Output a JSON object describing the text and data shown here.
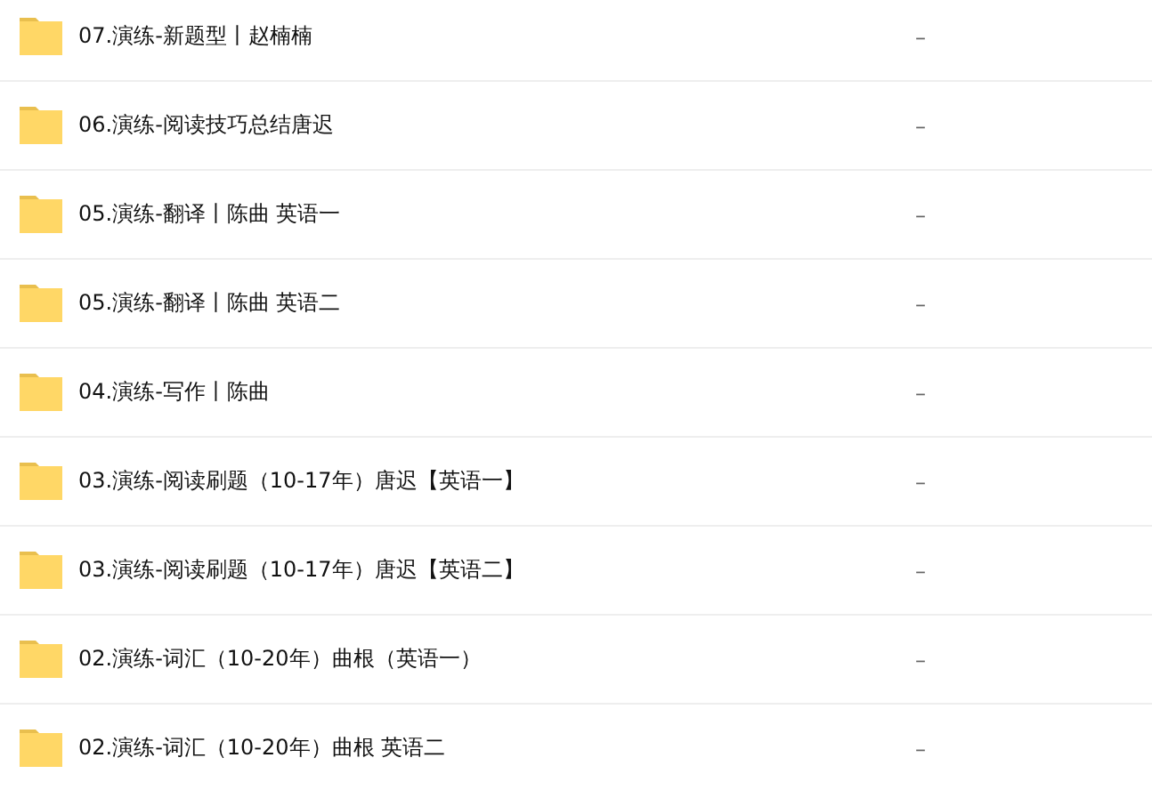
{
  "files": [
    {
      "name": "07.演练-新题型丨赵楠楠",
      "size": "–"
    },
    {
      "name": "06.演练-阅读技巧总结唐迟",
      "size": "–"
    },
    {
      "name": "05.演练-翻译丨陈曲 英语一",
      "size": "–"
    },
    {
      "name": "05.演练-翻译丨陈曲 英语二",
      "size": "–"
    },
    {
      "name": "04.演练-写作丨陈曲",
      "size": "–"
    },
    {
      "name": "03.演练-阅读刷题（10-17年）唐迟【英语一】",
      "size": "–"
    },
    {
      "name": "03.演练-阅读刷题（10-17年）唐迟【英语二】",
      "size": "–"
    },
    {
      "name": "02.演练-词汇（10-20年）曲根（英语一）",
      "size": "–"
    },
    {
      "name": "02.演练-词汇（10-20年）曲根 英语二",
      "size": "–"
    }
  ]
}
